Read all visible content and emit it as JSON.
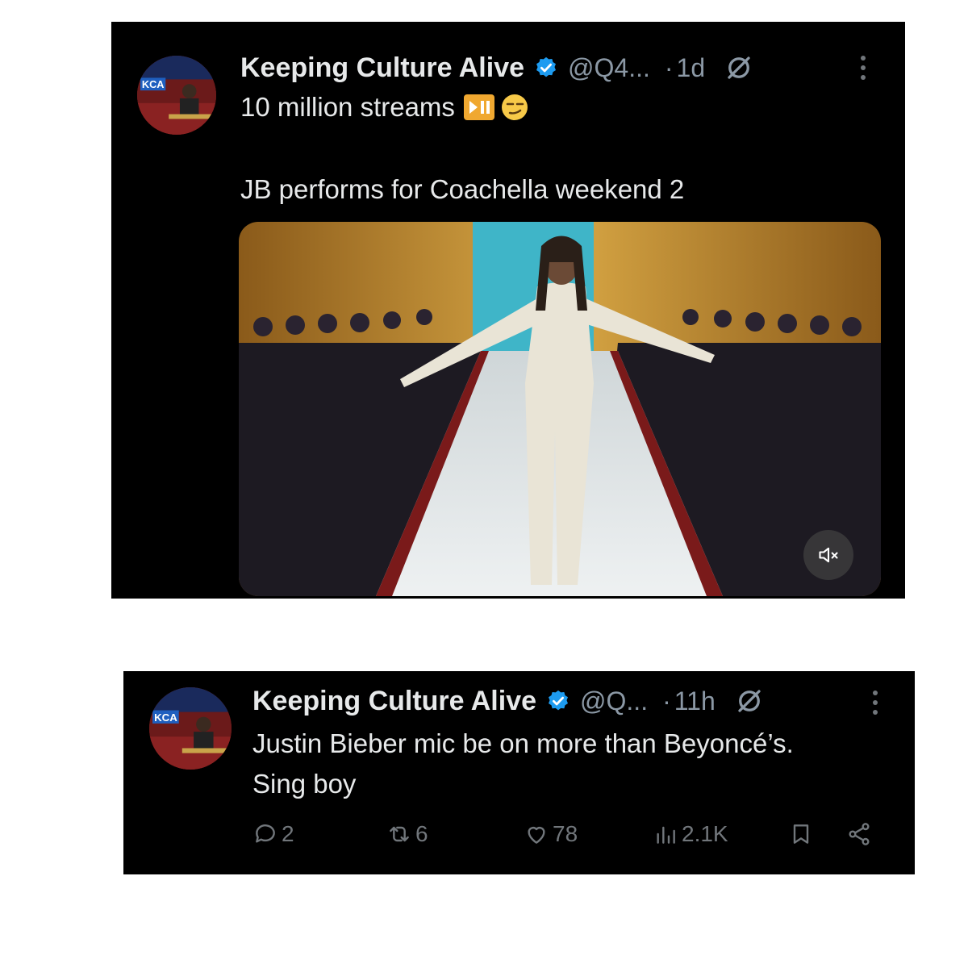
{
  "tweets": [
    {
      "author": {
        "name": "Keeping Culture Alive",
        "handle": "@Q4...",
        "verified": true,
        "avatar_text": "KCA"
      },
      "time": "1d",
      "text_line1": "10 million streams",
      "text_line2": "JB performs for Coachella weekend 2",
      "emojis": [
        "play-pause-emoji",
        "smirk-face-emoji"
      ],
      "media": {
        "type": "video",
        "muted": true
      }
    },
    {
      "author": {
        "name": "Keeping Culture Alive",
        "handle": "@Q...",
        "verified": true,
        "avatar_text": "KCA"
      },
      "time": "11h",
      "text_line1": "Justin Bieber mic be on more than Beyoncé’s.",
      "text_line2": "Sing boy",
      "actions": {
        "replies": "2",
        "reposts": "6",
        "likes": "78",
        "views": "2.1K"
      }
    }
  ],
  "separator": "·",
  "colors": {
    "background": "#000000",
    "text": "#e7e9ea",
    "muted": "#71767b",
    "verified": "#1d9bf0"
  }
}
